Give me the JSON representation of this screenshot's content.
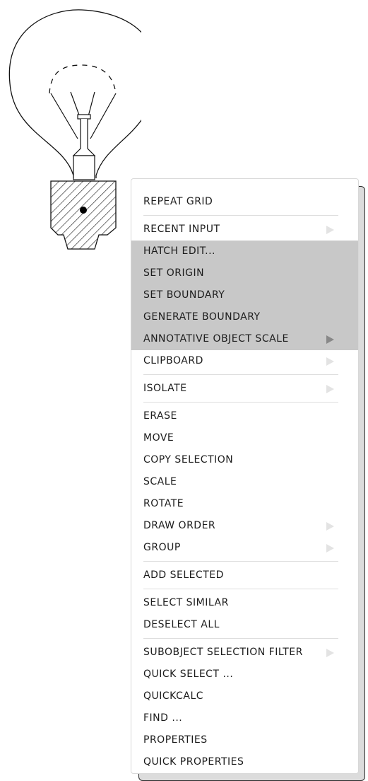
{
  "menu": {
    "items": [
      {
        "label": "REPEAT GRID",
        "submenu": false,
        "highlighted": false,
        "separator_after": true
      },
      {
        "label": "RECENT INPUT",
        "submenu": true,
        "highlighted": false,
        "separator_after": false
      },
      {
        "label": "HATCH EDIT...",
        "submenu": false,
        "highlighted": true,
        "separator_after": false
      },
      {
        "label": "SET ORIGIN",
        "submenu": false,
        "highlighted": true,
        "separator_after": false
      },
      {
        "label": "SET BOUNDARY",
        "submenu": false,
        "highlighted": true,
        "separator_after": false
      },
      {
        "label": "GENERATE BOUNDARY",
        "submenu": false,
        "highlighted": true,
        "separator_after": false
      },
      {
        "label": "ANNOTATIVE OBJECT SCALE",
        "submenu": true,
        "highlighted": true,
        "separator_after": false
      },
      {
        "label": "CLIPBOARD",
        "submenu": true,
        "highlighted": false,
        "separator_after": true
      },
      {
        "label": "ISOLATE",
        "submenu": true,
        "highlighted": false,
        "separator_after": true
      },
      {
        "label": "ERASE",
        "submenu": false,
        "highlighted": false,
        "separator_after": false
      },
      {
        "label": "MOVE",
        "submenu": false,
        "highlighted": false,
        "separator_after": false
      },
      {
        "label": "COPY SELECTION",
        "submenu": false,
        "highlighted": false,
        "separator_after": false
      },
      {
        "label": "SCALE",
        "submenu": false,
        "highlighted": false,
        "separator_after": false
      },
      {
        "label": "ROTATE",
        "submenu": false,
        "highlighted": false,
        "separator_after": false
      },
      {
        "label": "DRAW ORDER",
        "submenu": true,
        "highlighted": false,
        "separator_after": false
      },
      {
        "label": "GROUP",
        "submenu": true,
        "highlighted": false,
        "separator_after": true
      },
      {
        "label": "ADD SELECTED",
        "submenu": false,
        "highlighted": false,
        "separator_after": true
      },
      {
        "label": "SELECT SIMILAR",
        "submenu": false,
        "highlighted": false,
        "separator_after": false
      },
      {
        "label": "DESELECT ALL",
        "submenu": false,
        "highlighted": false,
        "separator_after": true
      },
      {
        "label": "SUBOBJECT SELECTION FILTER",
        "submenu": true,
        "highlighted": false,
        "separator_after": false
      },
      {
        "label": "QUICK SELECT ...",
        "submenu": false,
        "highlighted": false,
        "separator_after": false
      },
      {
        "label": "QUICKCALC",
        "submenu": false,
        "highlighted": false,
        "separator_after": false
      },
      {
        "label": "FIND ...",
        "submenu": false,
        "highlighted": false,
        "separator_after": false
      },
      {
        "label": "PROPERTIES",
        "submenu": false,
        "highlighted": false,
        "separator_after": false
      },
      {
        "label": "QUICK PROPERTIES",
        "submenu": false,
        "highlighted": false,
        "separator_after": false
      }
    ],
    "highlight_color": "#c8c8c8",
    "submenu_icon": "triangle-right-icon"
  },
  "drawing": {
    "subject": "light-bulb",
    "selected_object": "hatch"
  }
}
